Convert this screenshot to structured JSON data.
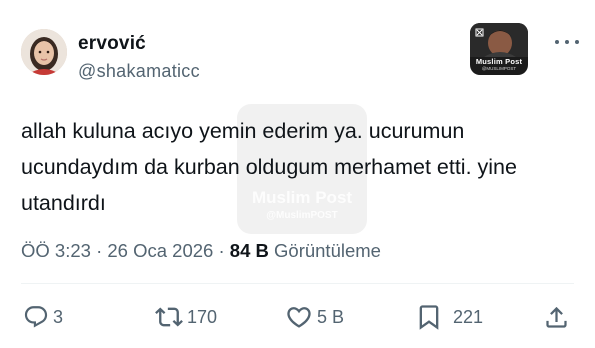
{
  "tweet": {
    "display_name": "ervović",
    "handle": "@shakamaticc",
    "text": "allah kuluna acıyo yemin ederim ya. ucurumun ucundaydım da kurban oldugum merhamet etti. yine utandırdı",
    "time": "ÖÖ 3:23",
    "date": "26 Oca 2026",
    "separator": "·",
    "views_count": "84 B",
    "views_label": "Görüntüleme"
  },
  "badge": {
    "label": "Muslim Post",
    "sub": "@MUSLIMPOST"
  },
  "watermark": {
    "title": "Muslim Post",
    "sub": "@MuslimPOST"
  },
  "actions": {
    "replies": "3",
    "retweets": "170",
    "likes": "5 B",
    "bookmarks": "221"
  },
  "icons": {
    "reply": "reply-icon",
    "retweet": "retweet-icon",
    "like": "heart-icon",
    "bookmark": "bookmark-icon",
    "share": "share-icon",
    "more": "more-icon"
  },
  "colors": {
    "text": "#0f1419",
    "secondary": "#536471",
    "divider": "#eff3f4"
  }
}
